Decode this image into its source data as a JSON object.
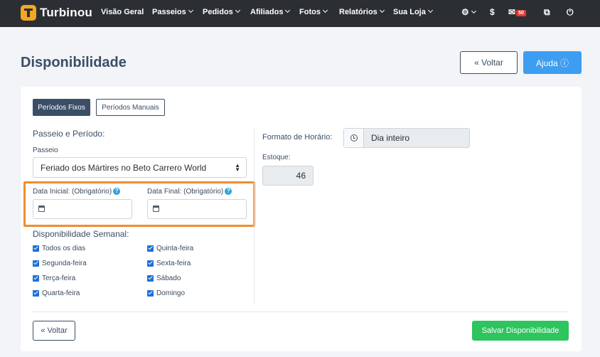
{
  "navbar": {
    "brand": "Turbinou",
    "items": [
      {
        "label": "Visão Geral",
        "dropdown": false
      },
      {
        "label": "Passeios",
        "dropdown": true
      },
      {
        "label": "Pedidos",
        "dropdown": true
      },
      {
        "label": "Afiliados",
        "dropdown": true
      },
      {
        "label": "Fotos",
        "dropdown": true
      },
      {
        "label": "Relatórios",
        "dropdown": true
      },
      {
        "label": "Sua Loja",
        "dropdown": true
      }
    ],
    "icons": {
      "settings": "gear-icon",
      "finance": "$",
      "mail": "mail-icon",
      "mail_badge": "50",
      "external": "external-link-icon",
      "power": "power-icon"
    }
  },
  "header": {
    "title": "Disponibilidade",
    "voltar_label": "« Voltar",
    "ajuda_label": "Ajuda ⓘ"
  },
  "tabs": {
    "fixos": "Períodos Fixos",
    "manuais": "Períodos Manuais"
  },
  "form": {
    "section_title": "Passeio e Período:",
    "passeio_label": "Passeio",
    "passeio_value": "Feriado dos Mártires no Beto Carrero World",
    "data_inicial_label": "Data Inicial: (Obrigatório)",
    "data_final_label": "Data Final: (Obrigatório)",
    "data_inicial_value": "",
    "data_final_value": "",
    "semanal_title": "Disponibilidade Semanal:",
    "days_left": [
      {
        "label": "Todos os dias",
        "checked": true
      },
      {
        "label": "Segunda-feira",
        "checked": true
      },
      {
        "label": "Terça-feira",
        "checked": true
      },
      {
        "label": "Quarta-feira",
        "checked": true
      }
    ],
    "days_right": [
      {
        "label": "Quinta-feira",
        "checked": true
      },
      {
        "label": "Sexta-feira",
        "checked": true
      },
      {
        "label": "Sábado",
        "checked": true
      },
      {
        "label": "Domingo",
        "checked": true
      }
    ],
    "formato_label": "Formato de Horário:",
    "formato_value": "Dia inteiro",
    "estoque_label": "Estoque:",
    "estoque_value": "46"
  },
  "footer": {
    "voltar_label": "« Voltar",
    "salvar_label": "Salvar Disponibilidade"
  },
  "colors": {
    "navbar": "#2b2f33",
    "primary": "#3a4e66",
    "ajuda": "#3d9df0",
    "salvar": "#2ec45e",
    "highlight": "#f08c32",
    "checkbox": "#1e6fd9"
  }
}
